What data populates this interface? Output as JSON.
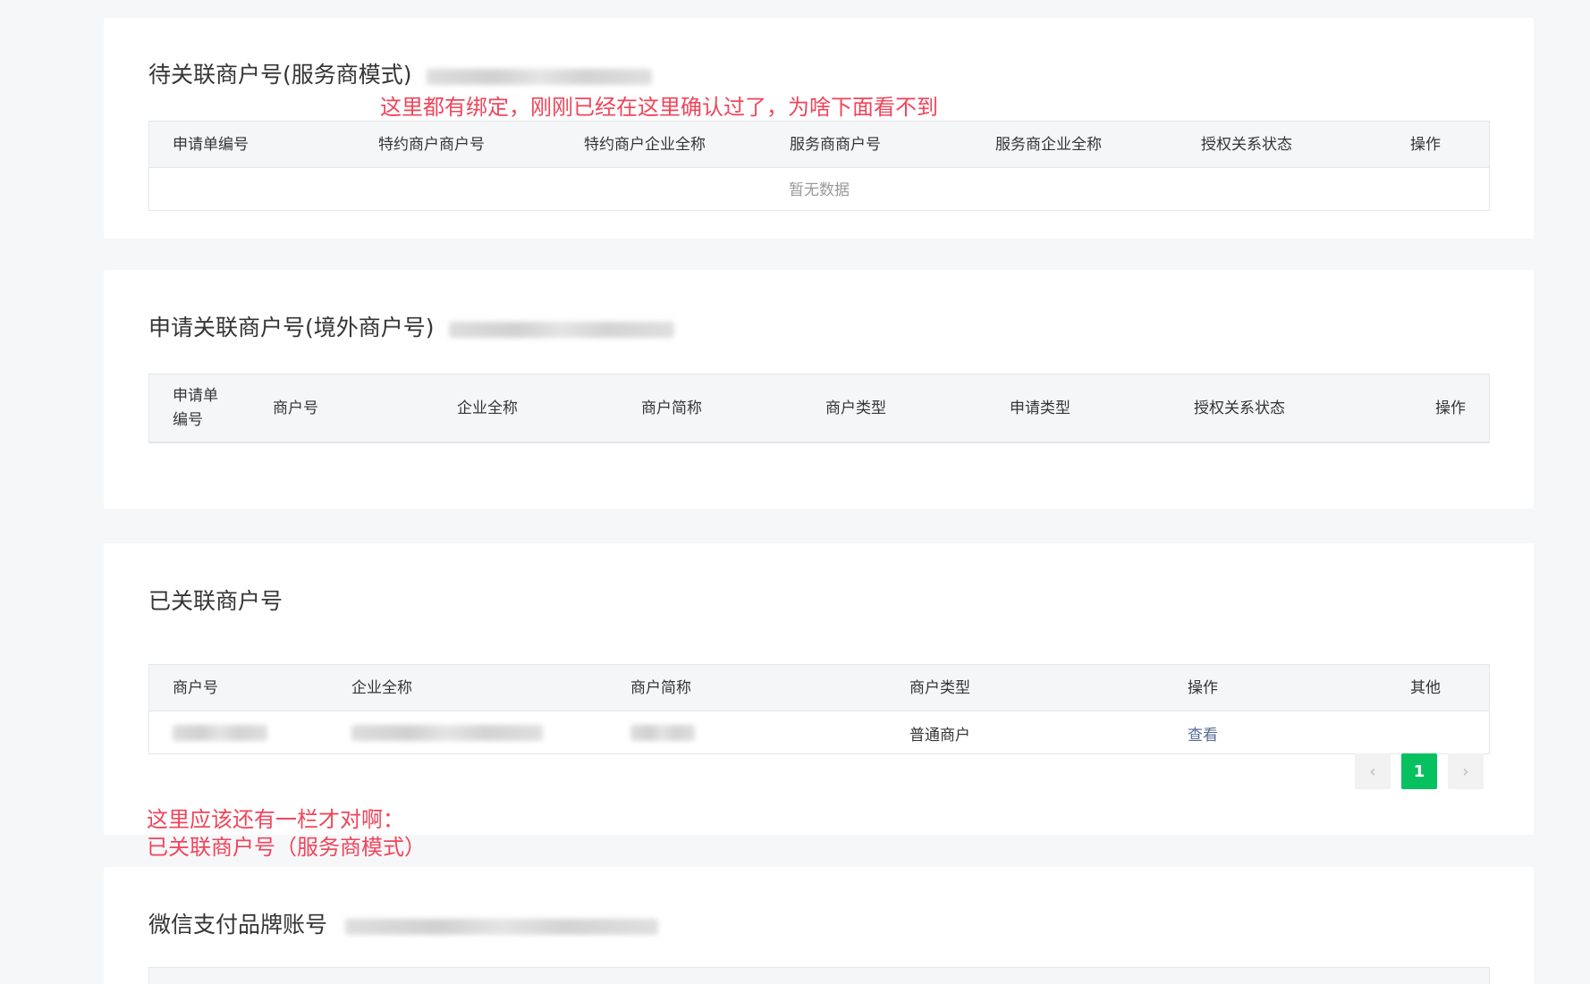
{
  "section1": {
    "title": "待关联商户号(服务商模式)",
    "annotation": "这里都有绑定，刚刚已经在这里确认过了，为啥下面看不到",
    "columns": [
      "申请单编号",
      "特约商户商户号",
      "特约商户企业全称",
      "服务商商户号",
      "服务商企业全称",
      "授权关系状态",
      "操作"
    ],
    "empty_text": "暂无数据"
  },
  "section2": {
    "title": "申请关联商户号(境外商户号)",
    "columns": [
      "申请单编号",
      "商户号",
      "企业全称",
      "商户简称",
      "商户类型",
      "申请类型",
      "授权关系状态",
      "操作"
    ]
  },
  "section3": {
    "title": "已关联商户号",
    "columns": [
      "商户号",
      "企业全称",
      "商户简称",
      "商户类型",
      "操作",
      "其他"
    ],
    "rows": [
      {
        "merchant_type": "普通商户",
        "action": "查看"
      }
    ],
    "pagination": {
      "current": "1",
      "prev": "‹",
      "next": "›"
    }
  },
  "annotation2": {
    "line1": "这里应该还有一栏才对啊：",
    "line2": "已关联商户号（服务商模式）"
  },
  "section4": {
    "title": "微信支付品牌账号"
  },
  "colors": {
    "accent_green": "#07c160",
    "link_blue": "#576b95",
    "annotation_red": "#f0455a"
  }
}
